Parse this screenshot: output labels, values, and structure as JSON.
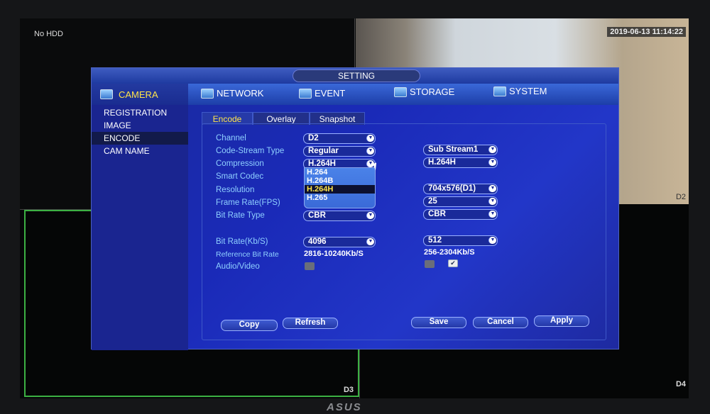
{
  "screen": {
    "no_hdd": "No HDD",
    "timestamp": "2019-06-13 11:14:22",
    "channels": [
      "D2",
      "D3",
      "D4"
    ]
  },
  "monitor_brand": "ASUS",
  "dialog": {
    "title": "SETTING",
    "side_header": "CAMERA",
    "side_items": [
      "REGISTRATION",
      "IMAGE",
      "ENCODE",
      "CAM NAME"
    ],
    "selected_side": "ENCODE",
    "top_nav": [
      "NETWORK",
      "EVENT",
      "STORAGE",
      "SYSTEM"
    ],
    "tabs": [
      "Encode",
      "Overlay",
      "Snapshot"
    ],
    "active_tab": "Encode",
    "fields": {
      "channel": {
        "label": "Channel",
        "main": "D2"
      },
      "code_stream": {
        "label": "Code-Stream Type",
        "main": "Regular",
        "sub": "Sub Stream1"
      },
      "compression": {
        "label": "Compression",
        "main": "H.264H",
        "sub": "H.264H"
      },
      "smart_codec": {
        "label": "Smart Codec"
      },
      "resolution": {
        "label": "Resolution",
        "sub": "704x576(D1)"
      },
      "frame_rate": {
        "label": "Frame Rate(FPS)",
        "sub": "25"
      },
      "bit_rate_type": {
        "label": "Bit Rate Type",
        "main": "CBR",
        "sub": "CBR"
      },
      "bit_rate": {
        "label": "Bit Rate(Kb/S)",
        "main": "4096",
        "sub": "512"
      },
      "ref_bit_rate": {
        "label": "Reference Bit Rate",
        "main": "2816-10240Kb/S",
        "sub": "256-2304Kb/S"
      },
      "audio_video": {
        "label": "Audio/Video",
        "main_checked": false,
        "sub_checked_1": false,
        "sub_checked_2": true
      }
    },
    "compression_options": [
      "H.264",
      "H.264B",
      "H.264H",
      "H.265"
    ],
    "compression_selected": "H.264H",
    "buttons": {
      "copy": "Copy",
      "refresh": "Refresh",
      "save": "Save",
      "cancel": "Cancel",
      "apply": "Apply"
    },
    "colors": {
      "accent": "#ffe44a",
      "label": "#8fd0ff",
      "background": "#1a2ab8"
    }
  }
}
